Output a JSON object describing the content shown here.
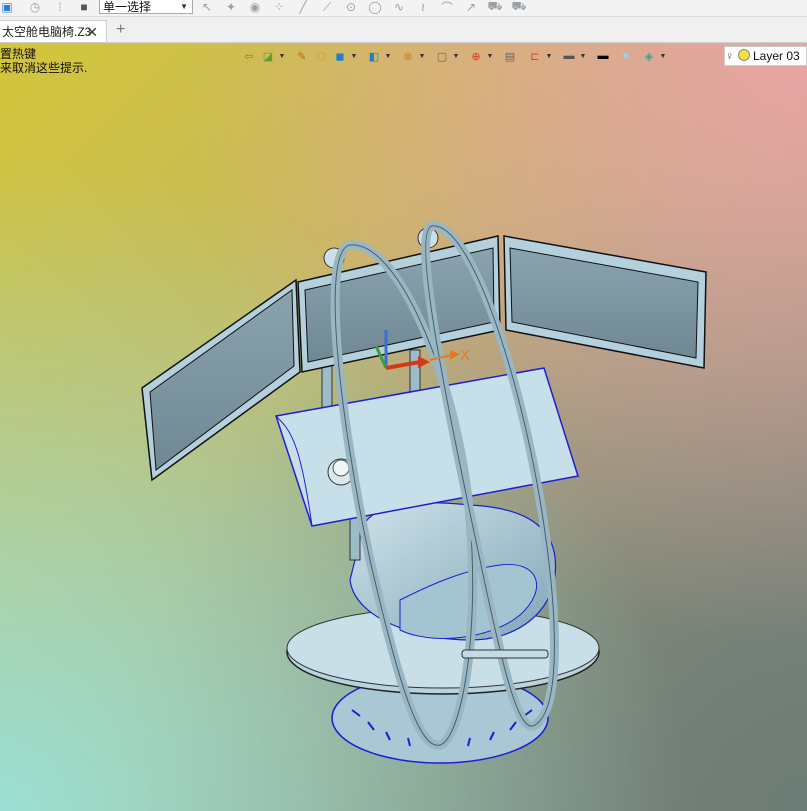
{
  "toolbar": {
    "selection_mode": "单一选择"
  },
  "tab": {
    "title": "太空舱电脑椅.Z3",
    "close_glyph": "✕",
    "add_glyph": "+"
  },
  "hint": {
    "line1": "置热键",
    "line2": "来取消这些提示."
  },
  "layer": {
    "label": "Layer 03"
  },
  "axis": {
    "x_label": "X"
  },
  "icons": [
    "part-icon",
    "history-icon",
    "sketch-icon",
    "select-icon",
    "arrow-icon",
    "pointer-icon",
    "play-icon",
    "point-icon",
    "line-icon",
    "curve-icon",
    "circle-icon",
    "arc-icon",
    "spline-icon",
    "wave-icon",
    "sweep-icon",
    "cursor-icon",
    "paint-icon",
    "stamp-icon",
    "home-view-icon",
    "render-icon",
    "pen-icon",
    "cube-icon",
    "box-icon",
    "shaded-icon",
    "wireframe-icon",
    "orbit-icon",
    "pan-icon",
    "frame-icon",
    "clip-icon",
    "background-icon",
    "black-swatch-icon",
    "swatch-icon",
    "layer-icon",
    "lightbulb-icon"
  ],
  "colors": {
    "model_fill": "#9fc3d0",
    "model_edge": "#1e1ed2",
    "axis_x": "#e07a2a"
  }
}
